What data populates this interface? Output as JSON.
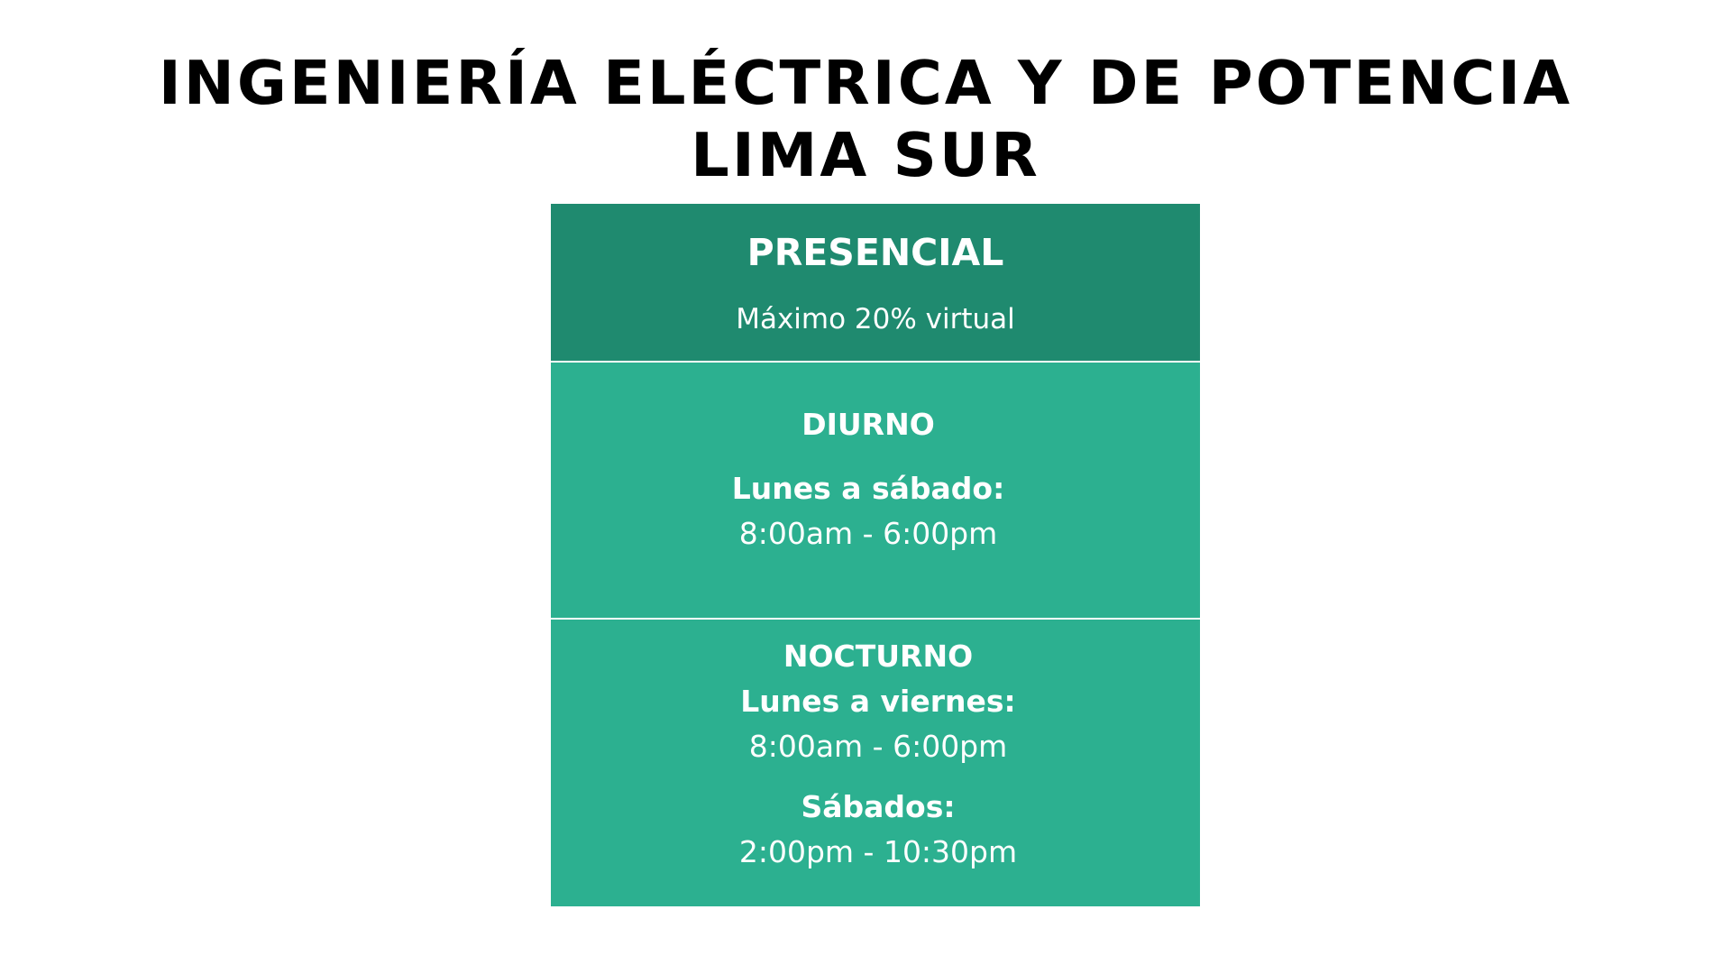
{
  "title": {
    "line1": "INGENIERÍA ELÉCTRICA Y DE POTENCIA",
    "line2": "LIMA SUR"
  },
  "card": {
    "header": {
      "heading": "PRESENCIAL",
      "subheading": "Máximo 20% virtual"
    },
    "diurno": {
      "heading": "DIURNO",
      "days": "Lunes a sábado:",
      "hours": "8:00am - 6:00pm"
    },
    "nocturno": {
      "heading": "NOCTURNO",
      "weekdays_label": "Lunes a viernes:",
      "weekdays_hours": "8:00am - 6:00pm",
      "saturday_label": "Sábados:",
      "saturday_hours": "2:00pm - 10:30pm"
    }
  },
  "colors": {
    "header_bg": "#1f8a6f",
    "body_bg": "#2cb090",
    "text_on_card": "#ffffff",
    "title_text": "#000000"
  }
}
